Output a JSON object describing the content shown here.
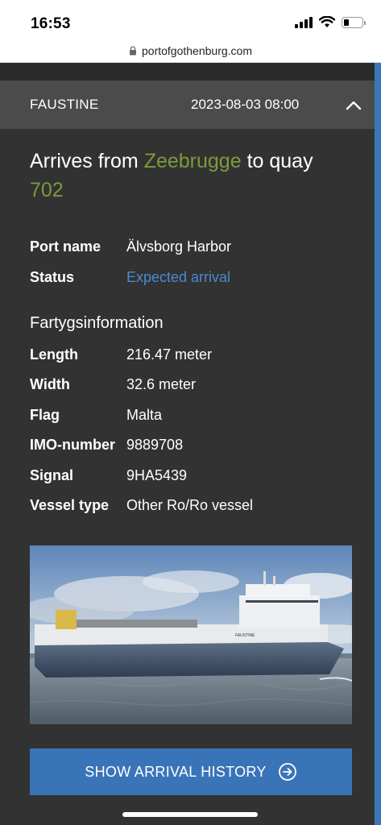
{
  "status_bar": {
    "time": "16:53"
  },
  "browser": {
    "url": "portofgothenburg.com"
  },
  "card": {
    "ship_name": "FAUSTINE",
    "datetime": "2023-08-03 08:00",
    "headline": {
      "prefix": "Arrives from ",
      "origin": "Zeebrugge",
      "middle": " to quay ",
      "quay": "702"
    },
    "port_info": [
      {
        "label": "Port name",
        "value": "Älvsborg Harbor"
      },
      {
        "label": "Status",
        "value": "Expected arrival"
      }
    ],
    "vessel_section_title": "Fartygsinformation",
    "vessel_info": [
      {
        "label": "Length",
        "value": "216.47 meter"
      },
      {
        "label": "Width",
        "value": "32.6 meter"
      },
      {
        "label": "Flag",
        "value": "Malta"
      },
      {
        "label": "IMO-number",
        "value": "9889708"
      },
      {
        "label": "Signal",
        "value": "9HA5439"
      },
      {
        "label": "Vessel type",
        "value": "Other Ro/Ro vessel"
      }
    ],
    "photo": {
      "hull_name": "FAUSTINE"
    },
    "history_button": "SHOW ARRIVAL HISTORY"
  },
  "colors": {
    "accent_green": "#7d9a3a",
    "status_blue": "#4a8ad0",
    "button_blue": "#3a74b8",
    "header_gray": "#4b4b4b"
  }
}
